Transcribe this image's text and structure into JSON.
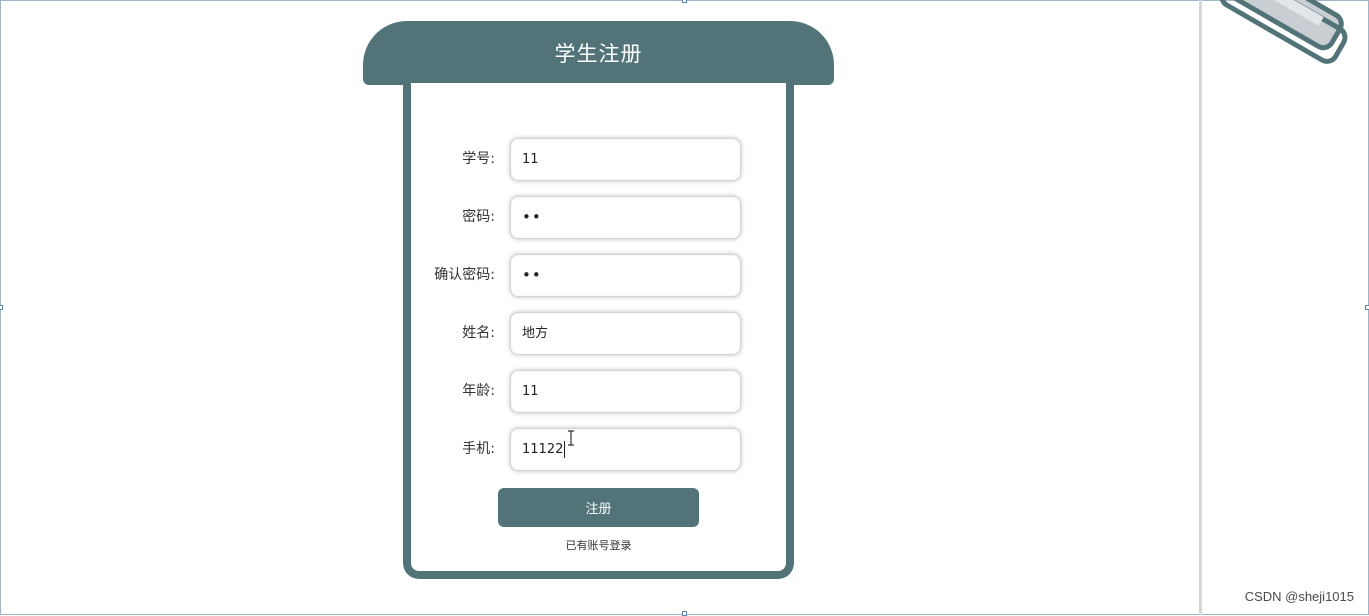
{
  "form": {
    "title": "学生注册",
    "fields": [
      {
        "label": "学号:",
        "value": "11"
      },
      {
        "label": "密码:",
        "value": "••"
      },
      {
        "label": "确认密码:",
        "value": "••"
      },
      {
        "label": "姓名:",
        "value": "地方"
      },
      {
        "label": "年龄:",
        "value": "11"
      },
      {
        "label": "手机:",
        "value": "11122"
      }
    ],
    "submit_label": "注册",
    "login_link": "已有账号登录"
  },
  "watermark": "CSDN @sheji1015",
  "colors": {
    "accent": "#527479"
  },
  "icons": {
    "cursor": "text-cursor-icon",
    "decor": "paperclip-icon"
  }
}
